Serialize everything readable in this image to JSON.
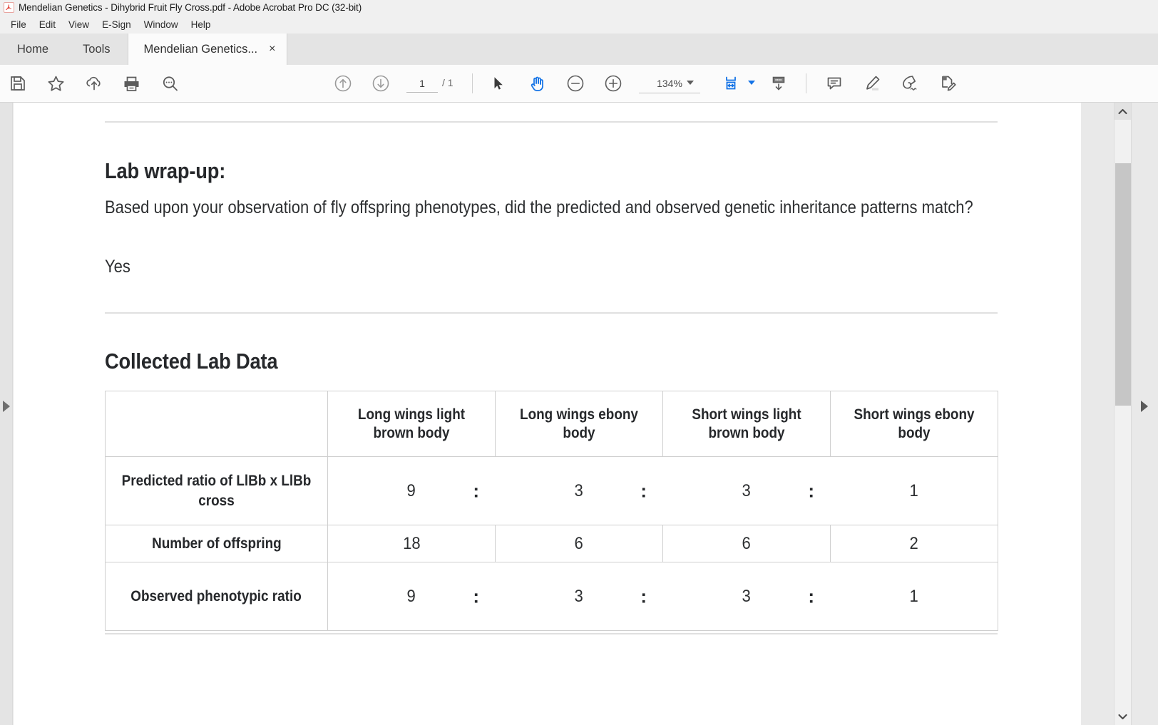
{
  "window": {
    "title": "Mendelian Genetics - Dihybrid Fruit Fly Cross.pdf - Adobe Acrobat Pro DC (32-bit)",
    "app_icon": "acrobat-logo-icon"
  },
  "menu": {
    "items": [
      {
        "label": "File"
      },
      {
        "label": "Edit"
      },
      {
        "label": "View"
      },
      {
        "label": "E-Sign"
      },
      {
        "label": "Window"
      },
      {
        "label": "Help"
      }
    ]
  },
  "tabs": {
    "home": "Home",
    "tools": "Tools",
    "document": "Mendelian Genetics...",
    "close_glyph": "×"
  },
  "toolbar": {
    "save": "save-icon",
    "star": "star-icon",
    "cloud_upload": "cloud-upload-icon",
    "print": "print-icon",
    "search": "search-icon",
    "prev_page": "arrow-up-circle-icon",
    "next_page": "arrow-down-circle-icon",
    "page_number": "1",
    "page_total": "/ 1",
    "select_tool": "cursor-arrow-icon",
    "hand_tool": "hand-icon",
    "zoom_out": "minus-circle-icon",
    "zoom_in": "plus-circle-icon",
    "zoom_level": "134%",
    "zoom_caret": "chevron-down-icon",
    "fit_width": "fit-width-icon",
    "fit_caret": "chevron-down-icon",
    "scroll_mode": "page-scroll-icon",
    "comment": "comment-icon",
    "highlight": "highlighter-icon",
    "sign": "sign-pen-icon",
    "edit_pdf": "edit-pdf-icon"
  },
  "navigation": {
    "left_rail_expand": "expand-left-panel-icon",
    "right_rail_expand": "expand-right-panel-icon",
    "scroll_up": "chevron-up-icon",
    "scroll_down": "chevron-down-icon",
    "scroll_thumb": "scrollbar-thumb"
  },
  "document": {
    "wrapup_heading": "Lab wrap-up:",
    "question": "Based upon your observation of fly offspring phenotypes, did the predicted and observed genetic inheritance patterns match?",
    "answer": "Yes",
    "collected_heading": "Collected Lab Data"
  },
  "chart_data": {
    "type": "table",
    "title": "Collected Lab Data",
    "columns": [
      "",
      "Long wings light brown body",
      "Long wings ebony body",
      "Short wings light brown body",
      "Short wings ebony body"
    ],
    "rows": [
      {
        "label": "Predicted ratio of LlBb x LlBb cross",
        "values": [
          "9",
          "3",
          "3",
          "1"
        ],
        "separator": ":",
        "is_ratio": true
      },
      {
        "label": "Number of offspring",
        "values": [
          "18",
          "6",
          "6",
          "2"
        ],
        "separator": "",
        "is_ratio": false
      },
      {
        "label": "Observed phenotypic ratio",
        "values": [
          "9",
          "3",
          "3",
          "1"
        ],
        "separator": ":",
        "is_ratio": true
      }
    ]
  },
  "colors": {
    "accent_blue": "#1473e6",
    "toolbar_icon": "#5c5c5c",
    "text": "#2d2f31",
    "table_border": "#cfcfcf"
  }
}
